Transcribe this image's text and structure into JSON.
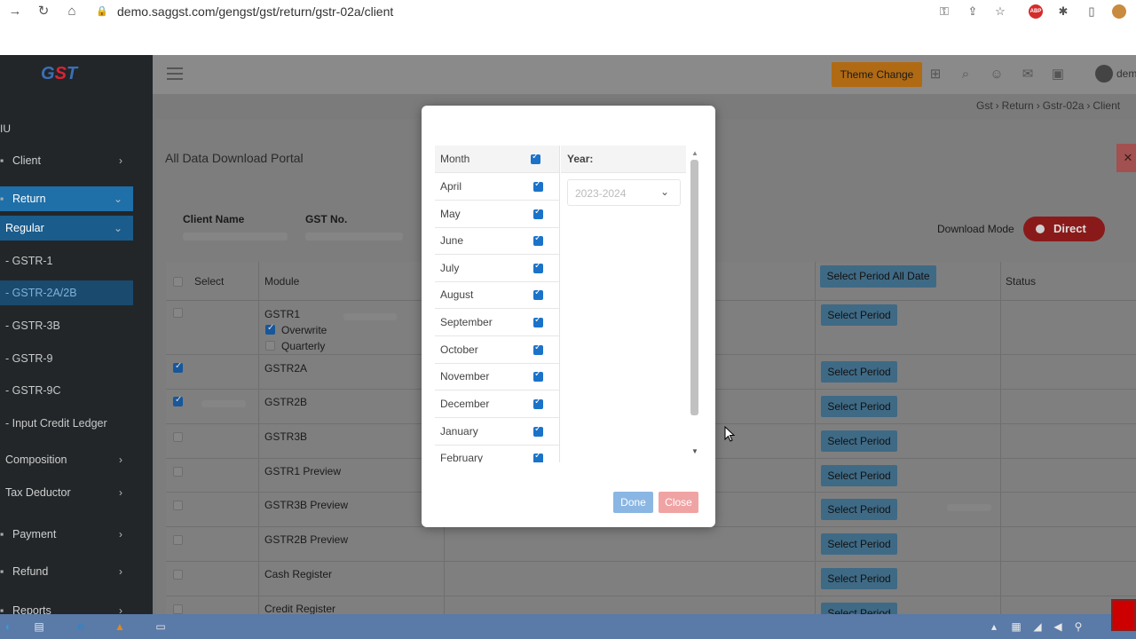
{
  "browser": {
    "url": "demo.saggst.com/gengst/gst/return/gstr-02a/client"
  },
  "app": {
    "logo": "GST",
    "section_letter": "IU",
    "user_name": "dem",
    "theme_button": "Theme Change",
    "breadcrumb": [
      "Gst",
      "Return",
      "Gstr-02a",
      "Client"
    ]
  },
  "sidebar": {
    "items": [
      {
        "label": "Client"
      },
      {
        "label": "Return"
      },
      {
        "label": "Regular"
      },
      {
        "label": "- GSTR-1"
      },
      {
        "label": "- GSTR-2A/2B"
      },
      {
        "label": "- GSTR-3B"
      },
      {
        "label": "- GSTR-9"
      },
      {
        "label": "- GSTR-9C"
      },
      {
        "label": "- Input Credit Ledger"
      },
      {
        "label": "Composition"
      },
      {
        "label": "Tax Deductor"
      },
      {
        "label": "Payment"
      },
      {
        "label": "Refund"
      },
      {
        "label": "Reports"
      }
    ]
  },
  "page": {
    "title": "All Data Download Portal",
    "client_name_label": "Client Name",
    "gst_no_label": "GST No.",
    "download_mode_label": "Download Mode",
    "download_mode_value": "Direct",
    "columns": {
      "select": "Select",
      "module": "Module",
      "period_all": "Select Period All Date",
      "status": "Status"
    },
    "select_period_label": "Select Period",
    "gstr1_options": [
      "Overwrite",
      "Quarterly"
    ],
    "rows": [
      {
        "module": "GSTR1",
        "checked": false
      },
      {
        "module": "GSTR2A",
        "checked": true
      },
      {
        "module": "GSTR2B",
        "checked": true
      },
      {
        "module": "GSTR3B",
        "checked": false
      },
      {
        "module": "GSTR1 Preview",
        "checked": false
      },
      {
        "module": "GSTR3B Preview",
        "checked": false
      },
      {
        "module": "GSTR2B Preview",
        "checked": false
      },
      {
        "module": "Cash Register",
        "checked": false
      },
      {
        "module": "Credit Register",
        "checked": false
      }
    ]
  },
  "modal": {
    "month_header": "Month",
    "year_label": "Year:",
    "year_value": "2023-2024",
    "months": [
      "April",
      "May",
      "June",
      "July",
      "August",
      "September",
      "October",
      "November",
      "December",
      "January",
      "February"
    ],
    "done_label": "Done",
    "close_label": "Close"
  },
  "colors": {
    "accent_blue": "#1b73c9",
    "theme_orange": "#e08a1c",
    "direct_red": "#c62828"
  }
}
